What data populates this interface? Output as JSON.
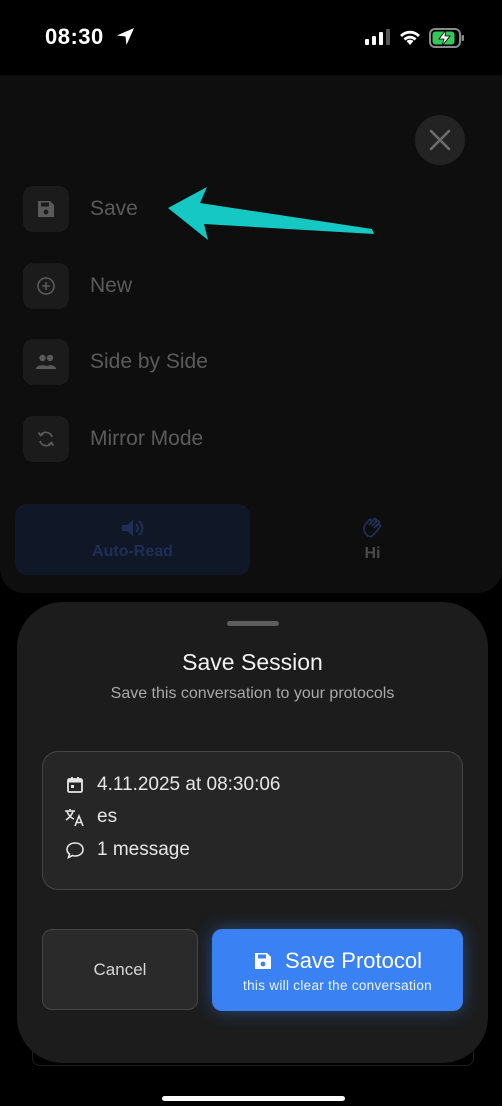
{
  "status": {
    "time": "08:30"
  },
  "menu": {
    "items": [
      {
        "label": "Save",
        "icon": "floppy-disk-icon"
      },
      {
        "label": "New",
        "icon": "plus-circle-icon"
      },
      {
        "label": "Side by Side",
        "icon": "people-icon"
      },
      {
        "label": "Mirror Mode",
        "icon": "sync-icon"
      }
    ],
    "close_icon": "close-icon"
  },
  "bottom_tabs": [
    {
      "label": "Auto-Read",
      "icon": "speaker-icon"
    },
    {
      "label": "Hi",
      "icon": "waving-hand-icon"
    }
  ],
  "sheet": {
    "title": "Save Session",
    "subtitle": "Save this conversation to your protocols",
    "info": {
      "date": "4.11.2025 at 08:30:06",
      "language": "es",
      "messages": "1 message"
    },
    "cancel_label": "Cancel",
    "save_label": "Save Protocol",
    "save_sublabel": "this will clear the conversation"
  },
  "colors": {
    "accent": "#3a82f4",
    "annotation_arrow": "#16c8c4",
    "sheet_bg": "#1c1c1c"
  }
}
